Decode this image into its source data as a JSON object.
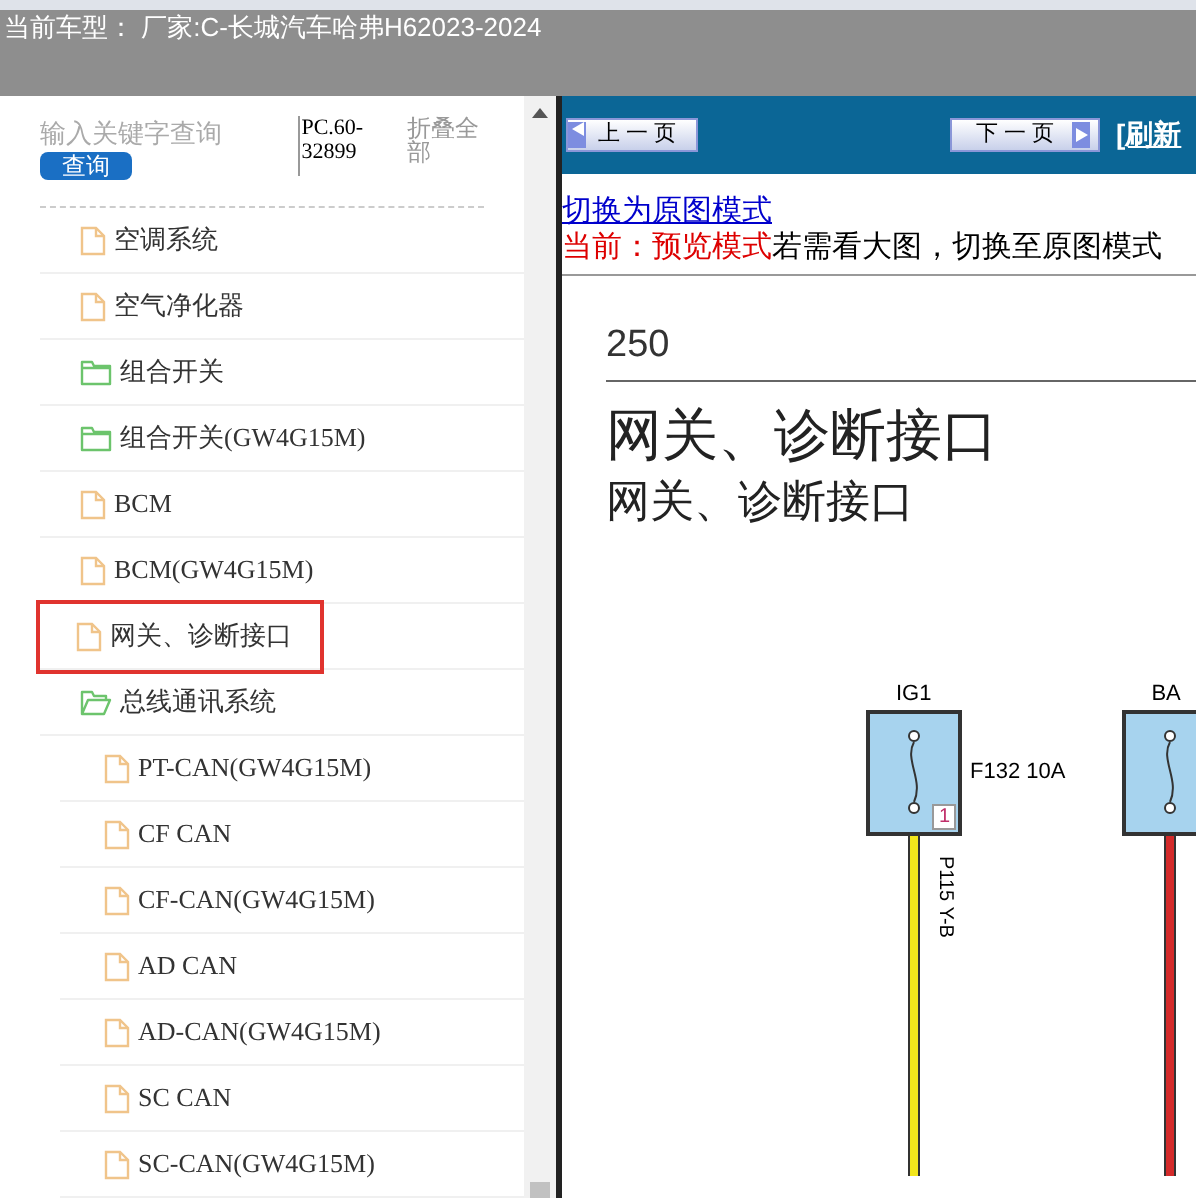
{
  "header": {
    "title": "当前车型：  厂家:C-长城汽车哈弗H62023-2024"
  },
  "sidebar": {
    "search": {
      "placeholder": "输入关键字查询",
      "button": "查询"
    },
    "code": "PC.60-32899",
    "collapse_all": "折叠全部",
    "tree": [
      {
        "label": "空调系统",
        "kind": "file",
        "selected": false
      },
      {
        "label": "空气净化器",
        "kind": "file",
        "selected": false
      },
      {
        "label": "组合开关",
        "kind": "folder",
        "expanded": false,
        "selected": false
      },
      {
        "label": "组合开关(GW4G15M)",
        "kind": "folder",
        "expanded": false,
        "selected": false
      },
      {
        "label": "BCM",
        "kind": "file",
        "selected": false
      },
      {
        "label": "BCM(GW4G15M)",
        "kind": "file",
        "selected": false
      },
      {
        "label": "网关、诊断接口",
        "kind": "file",
        "selected": true
      },
      {
        "label": "总线通讯系统",
        "kind": "folder",
        "expanded": true,
        "selected": false,
        "children": [
          {
            "label": "PT-CAN(GW4G15M)",
            "kind": "file",
            "selected": false
          },
          {
            "label": "CF CAN",
            "kind": "file",
            "selected": false
          },
          {
            "label": "CF-CAN(GW4G15M)",
            "kind": "file",
            "selected": false
          },
          {
            "label": "AD CAN",
            "kind": "file",
            "selected": false
          },
          {
            "label": "AD-CAN(GW4G15M)",
            "kind": "file",
            "selected": false
          },
          {
            "label": "SC CAN",
            "kind": "file",
            "selected": false
          },
          {
            "label": "SC-CAN(GW4G15M)",
            "kind": "file",
            "selected": false
          }
        ]
      }
    ]
  },
  "viewer": {
    "prev_button": "上一页",
    "next_button": "下一页",
    "refresh_link": "[刷新",
    "mode_link": "切换为原图模式",
    "mode_status": "当前：预览模式",
    "mode_hint": "若需看大图，切换至原图模式",
    "document": {
      "page_number": "250",
      "title": "网关、诊断接口",
      "subtitle": "网关、诊断接口",
      "fuses": [
        {
          "label": "IG1",
          "name": "F132 10A",
          "pin": "1",
          "wire_label": "P115 Y-B",
          "color": "#f2e61c"
        },
        {
          "label": "BA",
          "color": "#d42a2a"
        }
      ]
    }
  }
}
